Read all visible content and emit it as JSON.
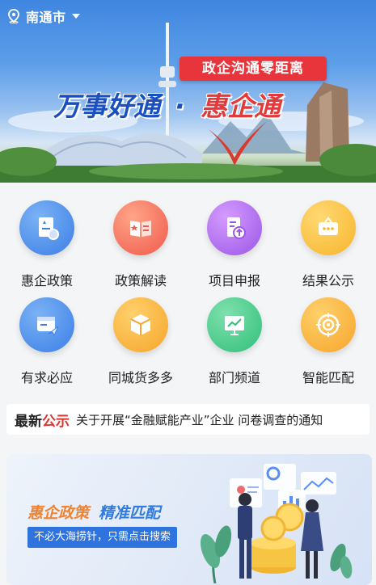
{
  "location": {
    "city": "南通市"
  },
  "banner": {
    "slogan": "政企沟通零距离",
    "title_left": "万事好通",
    "title_dot": "·",
    "title_right": "惠企通"
  },
  "menu": [
    {
      "label": "惠企政策",
      "icon": "policy-doc-icon",
      "color": "#3b7fe6"
    },
    {
      "label": "政策解读",
      "icon": "open-book-icon",
      "color": "#ef5a4c"
    },
    {
      "label": "项目申报",
      "icon": "upload-file-icon",
      "color": "#9a56e6"
    },
    {
      "label": "结果公示",
      "icon": "board-icon",
      "color": "#f7b52b"
    },
    {
      "label": "有求必应",
      "icon": "message-send-icon",
      "color": "#3b7fe6"
    },
    {
      "label": "同城货多多",
      "icon": "cube-icon",
      "color": "#f6a52a"
    },
    {
      "label": "部门频道",
      "icon": "chart-board-icon",
      "color": "#2fbf7a"
    },
    {
      "label": "智能匹配",
      "icon": "target-icon",
      "color": "#f6a52a"
    }
  ],
  "notice": {
    "prefix_a": "最新",
    "prefix_b": "公示",
    "text": "关于开展“金融赋能产业”企业 问卷调查的通知"
  },
  "promo": {
    "title_a": "惠企政策",
    "title_b": "精准匹配",
    "subtitle": "不必大海捞针，只需点击搜索"
  }
}
